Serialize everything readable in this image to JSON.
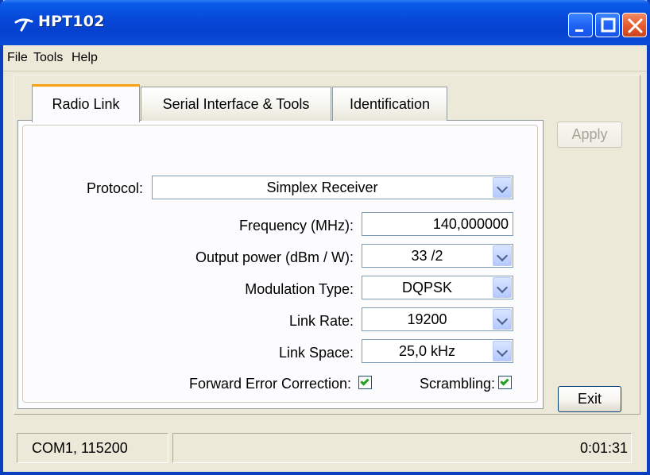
{
  "window": {
    "title": "HPT102",
    "icon": "radio-app-icon"
  },
  "menu": {
    "file": "File",
    "tools": "Tools",
    "help": "Help"
  },
  "tabs": [
    {
      "label": "Radio Link",
      "selected": true
    },
    {
      "label": "Serial Interface & Tools",
      "selected": false
    },
    {
      "label": "Identification",
      "selected": false
    }
  ],
  "radio_link": {
    "protocol": {
      "label": "Protocol:",
      "value": "Simplex Receiver"
    },
    "frequency": {
      "label": "Frequency (MHz):",
      "value": "140,000000"
    },
    "output_power": {
      "label": "Output power (dBm / W):",
      "value": "33 /2"
    },
    "modulation_type": {
      "label": "Modulation Type:",
      "value": "DQPSK"
    },
    "link_rate": {
      "label": "Link Rate:",
      "value": "19200"
    },
    "link_space": {
      "label": "Link Space:",
      "value": "25,0 kHz"
    },
    "forward_error_correction": {
      "label": "Forward Error Correction:",
      "checked": true
    },
    "scrambling": {
      "label": "Scrambling:",
      "checked": true
    }
  },
  "buttons": {
    "apply": "Apply",
    "exit": "Exit"
  },
  "status": {
    "connection": "COM1, 115200",
    "elapsed": "0:01:31"
  },
  "colors": {
    "titlebar": "#0747d6",
    "tab_highlight": "#f5a30f",
    "checkmark": "#21a121",
    "field_border": "#7f9db9"
  }
}
